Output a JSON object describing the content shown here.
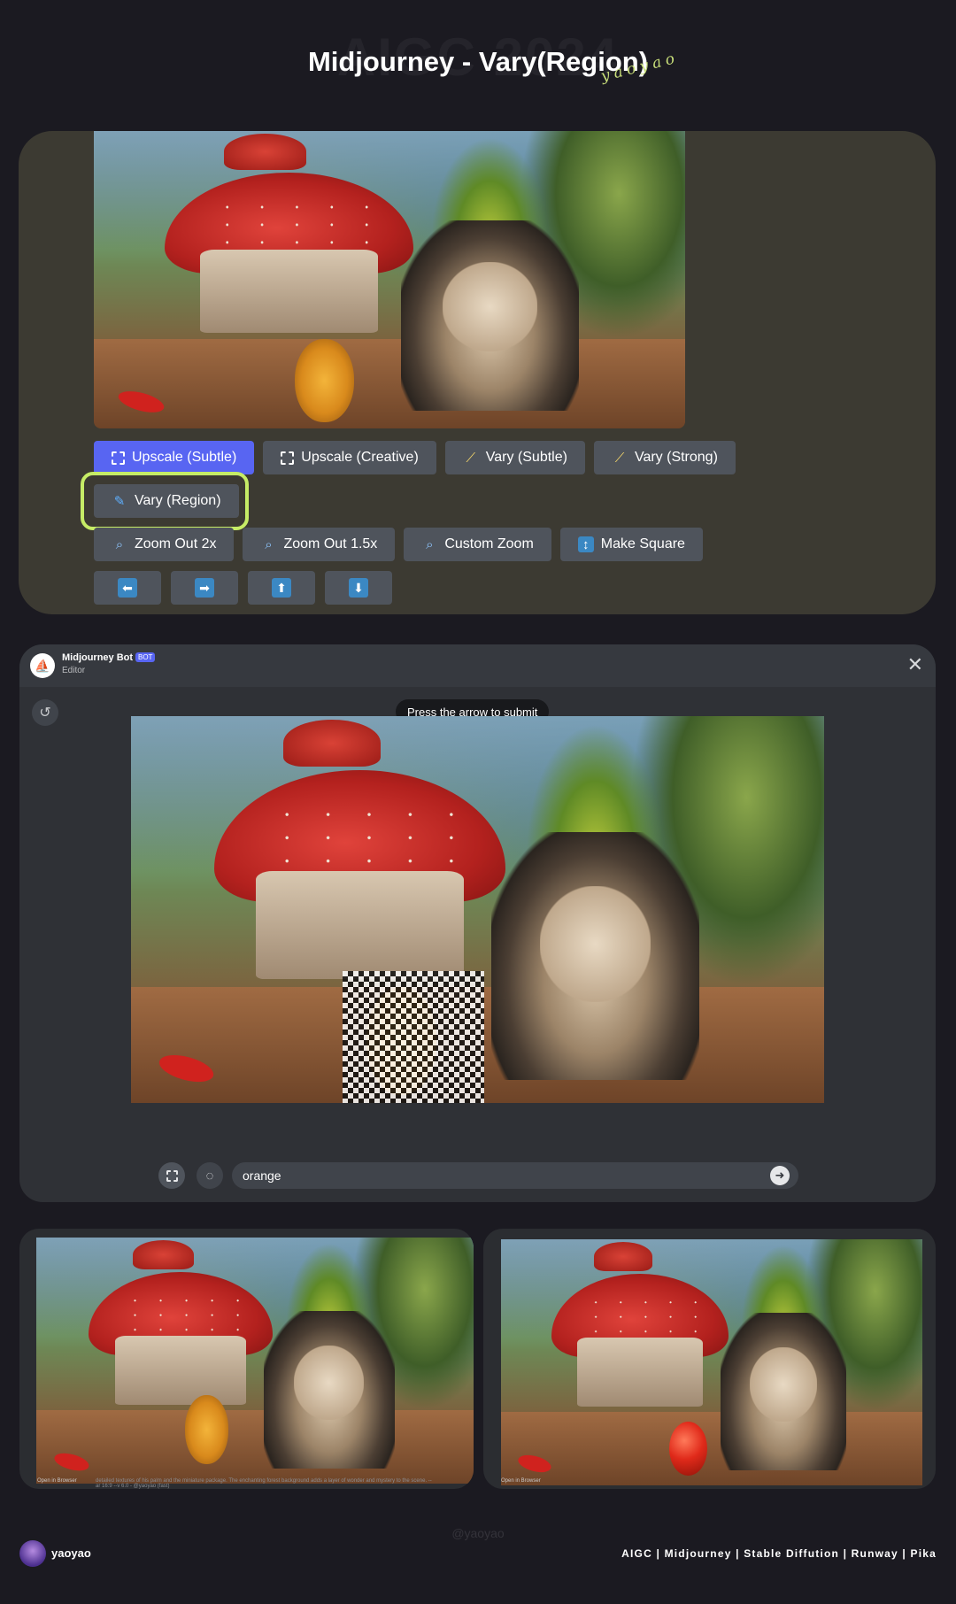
{
  "header": {
    "watermark": "AIGC 2024",
    "title": "Midjourney - Vary(Region)",
    "signature": "yaoyao"
  },
  "panel_buttons": {
    "row1": [
      {
        "label": "Upscale (Subtle)",
        "icon": "expand-icon",
        "primary": true
      },
      {
        "label": "Upscale (Creative)",
        "icon": "expand-icon",
        "primary": false
      },
      {
        "label": "Vary (Subtle)",
        "icon": "magic-wand-icon",
        "primary": false
      },
      {
        "label": "Vary (Strong)",
        "icon": "magic-wand-icon",
        "primary": false
      }
    ],
    "row2": [
      {
        "label": "Vary (Region)",
        "icon": "paintbrush-icon",
        "highlighted": true
      }
    ],
    "row3": [
      {
        "label": "Zoom Out 2x",
        "icon": "magnifier-icon"
      },
      {
        "label": "Zoom Out 1.5x",
        "icon": "magnifier-icon"
      },
      {
        "label": "Custom Zoom",
        "icon": "magnifier-icon"
      },
      {
        "label": "Make Square",
        "icon": "up-down-arrow-icon"
      }
    ],
    "row4": [
      {
        "glyph": "⬅",
        "icon": "arrow-left-icon"
      },
      {
        "glyph": "➡",
        "icon": "arrow-right-icon"
      },
      {
        "glyph": "⬆",
        "icon": "arrow-up-icon"
      },
      {
        "glyph": "⬇",
        "icon": "arrow-down-icon"
      }
    ],
    "highlight_color": "#c6ec66",
    "primary_color": "#5865f2"
  },
  "editor": {
    "bot_name": "Midjourney Bot",
    "bot_tag": "BOT",
    "subtitle": "Editor",
    "tooltip": "Press the arrow to submit",
    "prompt_value": "orange",
    "close_glyph": "✕",
    "undo_glyph": "↺",
    "submit_glyph": "➜",
    "lasso_glyph": "◌"
  },
  "results": {
    "open_label": "Open in Browser",
    "caption": "detailed textures of his palm and the miniature package. The enchanting forest background adds a layer of wonder and mystery to the scene. --ar 16:9 --v 6.0 - @yaoyao (fast)"
  },
  "footer": {
    "watermark": "@yaoyao",
    "author": "yaoyao",
    "tags": "AIGC | Midjourney | Stable Diffution | Runway | Pika"
  }
}
